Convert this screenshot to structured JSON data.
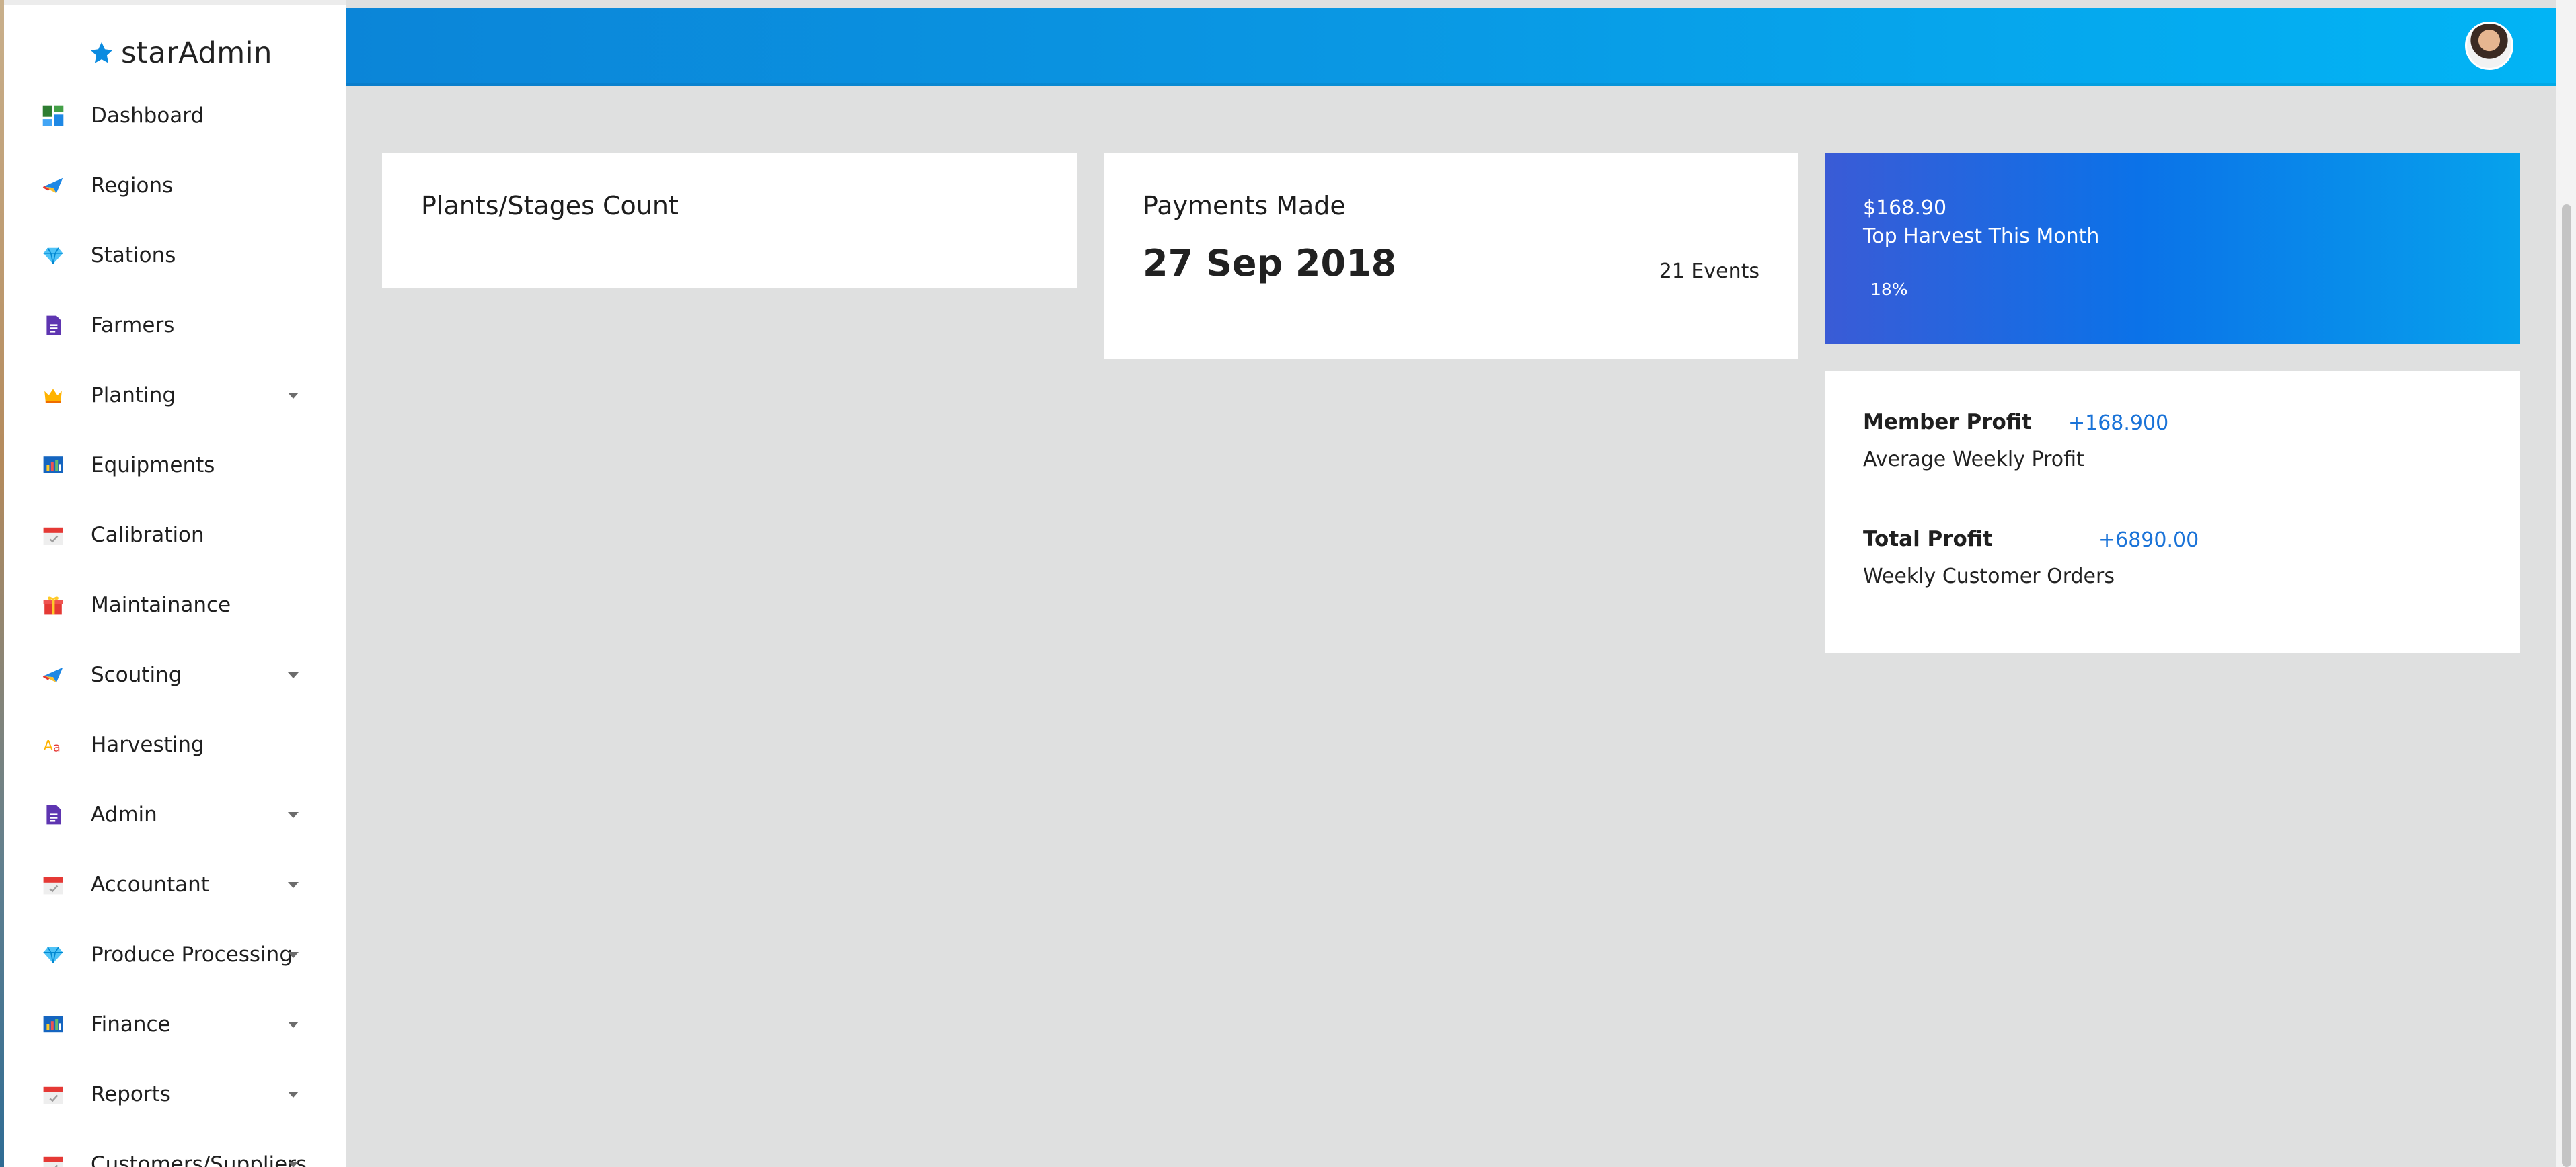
{
  "brand": {
    "prefix": "star",
    "suffix": "Admin"
  },
  "colors": {
    "accent": "#0b85d8",
    "accent_light": "#02b4f5",
    "profit_value": "#1a73d8",
    "background": "#dfe0e0"
  },
  "sidebar": {
    "items": [
      {
        "label": "Dashboard",
        "icon": "dashboard-icon",
        "has_caret": false
      },
      {
        "label": "Regions",
        "icon": "paper-plane-icon",
        "has_caret": false
      },
      {
        "label": "Stations",
        "icon": "diamond-icon",
        "has_caret": false
      },
      {
        "label": "Farmers",
        "icon": "document-icon",
        "has_caret": false
      },
      {
        "label": "Planting",
        "icon": "crown-icon",
        "has_caret": true
      },
      {
        "label": "Equipments",
        "icon": "chart-icon",
        "has_caret": false
      },
      {
        "label": "Calibration",
        "icon": "calendar-icon",
        "has_caret": false
      },
      {
        "label": "Maintainance",
        "icon": "gift-icon",
        "has_caret": false
      },
      {
        "label": "Scouting",
        "icon": "paper-plane-icon",
        "has_caret": true
      },
      {
        "label": "Harvesting",
        "icon": "font-icon",
        "has_caret": false
      },
      {
        "label": "Admin",
        "icon": "document-icon",
        "has_caret": true
      },
      {
        "label": "Accountant",
        "icon": "calendar-icon",
        "has_caret": true
      },
      {
        "label": "Produce Processing",
        "icon": "diamond-icon",
        "has_caret": true
      },
      {
        "label": "Finance",
        "icon": "chart-icon",
        "has_caret": true
      },
      {
        "label": "Reports",
        "icon": "calendar-icon",
        "has_caret": true
      },
      {
        "label": "Customers/Suppliers",
        "icon": "calendar-icon",
        "has_caret": true
      }
    ]
  },
  "cards": {
    "plants": {
      "title": "Plants/Stages Count"
    },
    "payments": {
      "title": "Payments Made",
      "date": "27 Sep 2018",
      "events": "21 Events"
    },
    "harvest": {
      "amount": "$168.90",
      "subtitle": "Top Harvest This Month",
      "percent": "18%"
    },
    "profit": {
      "member_title": "Member Profit",
      "member_value": "+168.900",
      "member_sub": "Average Weekly Profit",
      "total_title": "Total Profit",
      "total_value": "+6890.00",
      "total_sub": "Weekly Customer Orders"
    }
  }
}
